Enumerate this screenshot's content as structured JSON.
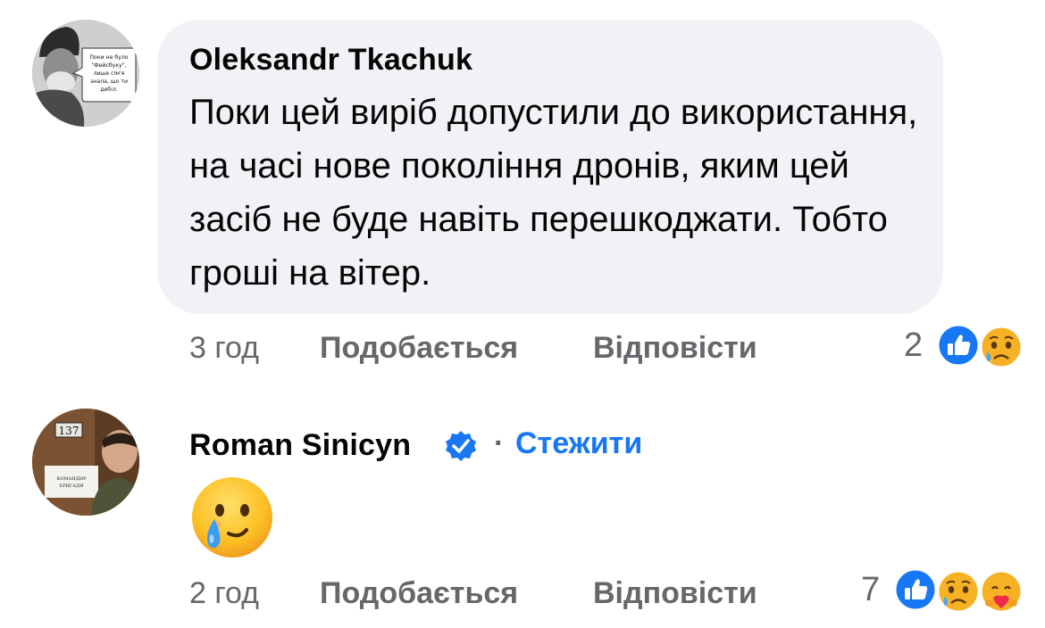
{
  "comments": [
    {
      "author": "Oleksandr Tkachuk",
      "avatar_caption": [
        "Поки не було",
        "\"Фейсбуку\",",
        "лише сім'я",
        "знала, що ти",
        "дебіл."
      ],
      "text": "Поки цей виріб допустили до використання, на часі нове покоління дронів, яким цей засіб не буде навіть перешкоджати. Тобто гроші на вітер.",
      "time": "3 год",
      "like_label": "Подобається",
      "reply_label": "Відповісти",
      "reaction_count": "2",
      "reactions": [
        "like-icon",
        "sad-icon"
      ]
    },
    {
      "author": "Roman Sinicyn",
      "verified": true,
      "avatar_caption": {
        "number": "137",
        "sign_line1": "КОМАНДИР",
        "sign_line2": "БРИГАДИ"
      },
      "follow_separator": "·",
      "follow_label": "Стежити",
      "content_emoji": "face-holding-back-tears-emoji",
      "time": "2 год",
      "like_label": "Подобається",
      "reply_label": "Відповісти",
      "reaction_count": "7",
      "reactions": [
        "like-icon",
        "sad-icon",
        "care-icon"
      ]
    }
  ],
  "colors": {
    "bubble": "#f0f2f5",
    "meta_text": "#65676b",
    "link_blue": "#1877f2",
    "like_blue": "#1877f2"
  }
}
